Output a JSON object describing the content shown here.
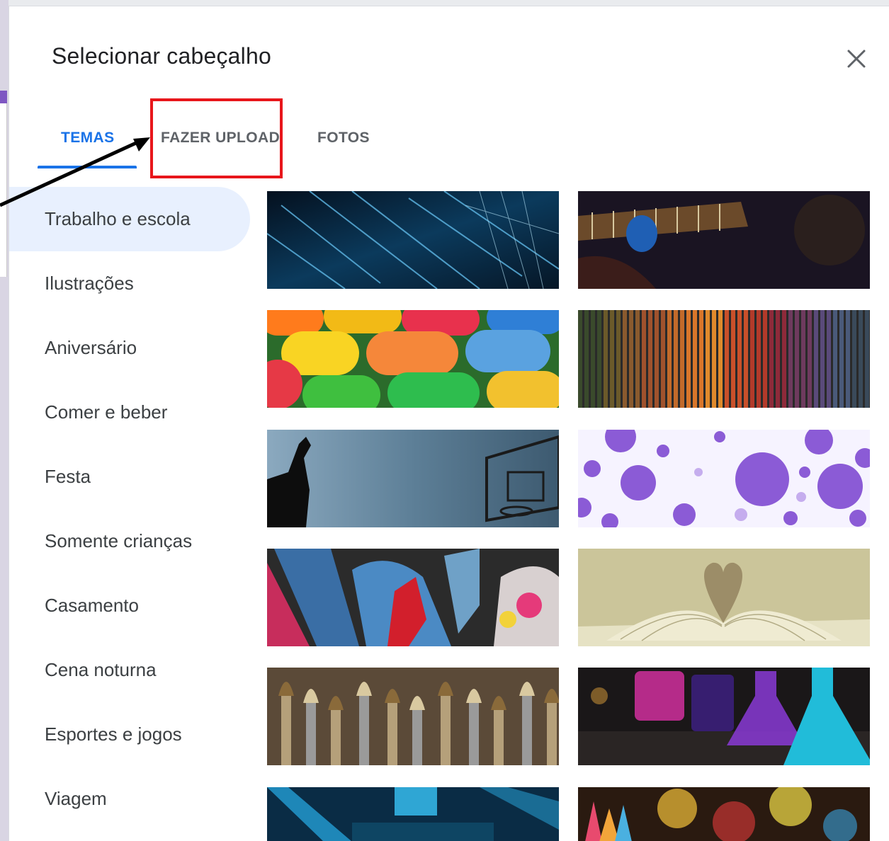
{
  "dialog": {
    "title": "Selecionar cabeçalho",
    "close_icon": "close-icon"
  },
  "tabs": [
    {
      "label": "TEMAS",
      "selected": true
    },
    {
      "label": "FAZER UPLOAD",
      "selected": false,
      "highlighted": true
    },
    {
      "label": "FOTOS",
      "selected": false
    }
  ],
  "categories": [
    {
      "label": "Trabalho e escola",
      "selected": true
    },
    {
      "label": "Ilustrações",
      "selected": false
    },
    {
      "label": "Aniversário",
      "selected": false
    },
    {
      "label": "Comer e beber",
      "selected": false
    },
    {
      "label": "Festa",
      "selected": false
    },
    {
      "label": "Somente crianças",
      "selected": false
    },
    {
      "label": "Casamento",
      "selected": false
    },
    {
      "label": "Cena noturna",
      "selected": false
    },
    {
      "label": "Esportes e jogos",
      "selected": false
    },
    {
      "label": "Viagem",
      "selected": false
    }
  ],
  "colors": {
    "accent": "#1a73e8",
    "selected_background": "#e8f0fe",
    "highlight_box": "#e8161b",
    "annotation_arrow": "#000000"
  }
}
